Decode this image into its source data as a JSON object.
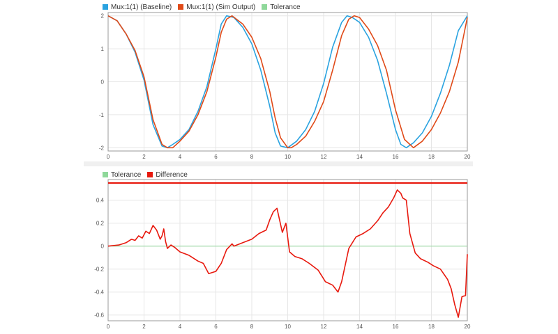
{
  "chart_data": [
    {
      "type": "line",
      "legend": [
        {
          "name": "Mux:1(1) (Baseline)",
          "color": "#2aa3e0"
        },
        {
          "name": "Mux:1(1) (Sim Output)",
          "color": "#e04a18"
        },
        {
          "name": "Tolerance",
          "color": "#8fd89a"
        }
      ],
      "xlim": [
        0,
        20
      ],
      "ylim": [
        -2.1,
        2.1
      ],
      "x_ticks": [
        "0",
        "2",
        "4",
        "6",
        "8",
        "10",
        "12",
        "14",
        "16",
        "18",
        "20"
      ],
      "y_ticks": [
        "2",
        "1",
        "0",
        "-1",
        "-2"
      ],
      "grid": true,
      "legend_position": "top-left",
      "series": [
        {
          "name": "Mux:1(1) (Baseline)",
          "color": "#2aa3e0",
          "x": [
            0,
            0.5,
            1,
            1.5,
            2,
            2.5,
            3,
            3.3,
            3.6,
            4,
            4.5,
            5,
            5.5,
            6,
            6.3,
            6.6,
            7,
            7.5,
            8,
            8.5,
            9,
            9.3,
            9.6,
            10,
            10.5,
            11,
            11.5,
            12,
            12.5,
            13,
            13.3,
            13.6,
            14,
            14.5,
            15,
            15.5,
            16,
            16.3,
            16.6,
            17,
            17.5,
            18,
            18.5,
            19,
            19.5,
            20
          ],
          "y": [
            2.0,
            1.85,
            1.45,
            0.9,
            0.05,
            -1.3,
            -1.95,
            -2.0,
            -1.9,
            -1.75,
            -1.45,
            -0.9,
            -0.15,
            1.0,
            1.75,
            2.0,
            1.95,
            1.65,
            1.15,
            0.35,
            -0.75,
            -1.55,
            -1.95,
            -2.0,
            -1.8,
            -1.45,
            -0.9,
            -0.05,
            1.05,
            1.8,
            2.0,
            1.95,
            1.8,
            1.35,
            0.65,
            -0.35,
            -1.45,
            -1.9,
            -2.0,
            -1.85,
            -1.55,
            -1.05,
            -0.35,
            0.5,
            1.55,
            2.0
          ]
        },
        {
          "name": "Mux:1(1) (Sim Output)",
          "color": "#e04a18",
          "x": [
            0,
            0.5,
            1,
            1.5,
            2,
            2.5,
            3,
            3.3,
            3.6,
            4,
            4.5,
            5,
            5.5,
            6,
            6.3,
            6.6,
            6.9,
            7.5,
            8,
            8.5,
            9,
            9.3,
            9.6,
            10,
            10.2,
            10.5,
            11,
            11.5,
            12,
            12.5,
            13,
            13.4,
            13.7,
            14,
            14.5,
            15,
            15.5,
            16,
            16.5,
            17,
            17.5,
            18,
            18.5,
            19,
            19.5,
            20
          ],
          "y": [
            2.0,
            1.85,
            1.45,
            0.95,
            0.15,
            -1.15,
            -1.9,
            -2.0,
            -2.0,
            -1.8,
            -1.5,
            -1.0,
            -0.3,
            0.75,
            1.5,
            1.9,
            2.0,
            1.75,
            1.35,
            0.7,
            -0.3,
            -1.1,
            -1.7,
            -2.0,
            -2.0,
            -1.9,
            -1.65,
            -1.2,
            -0.6,
            0.35,
            1.4,
            1.9,
            2.0,
            1.95,
            1.6,
            1.1,
            0.35,
            -0.85,
            -1.75,
            -2.0,
            -1.8,
            -1.45,
            -0.95,
            -0.3,
            0.6,
            1.95
          ]
        },
        {
          "name": "Tolerance",
          "color": "#8fd89a",
          "x": [],
          "y": []
        }
      ]
    },
    {
      "type": "line",
      "legend": [
        {
          "name": "Tolerance",
          "color": "#8fd89a"
        },
        {
          "name": "Difference",
          "color": "#e8190e"
        }
      ],
      "xlim": [
        0,
        20
      ],
      "ylim": [
        -0.65,
        0.58
      ],
      "x_ticks": [
        "0",
        "2",
        "4",
        "6",
        "8",
        "10",
        "12",
        "14",
        "16",
        "18",
        "20"
      ],
      "y_ticks": [
        "0.4",
        "0.2",
        "0",
        "-0.2",
        "-0.4",
        "-0.6"
      ],
      "grid": true,
      "legend_position": "top-left",
      "series": [
        {
          "name": "Tolerance",
          "color": "#8fd89a",
          "x": [
            0,
            20
          ],
          "y": [
            0,
            0
          ]
        },
        {
          "name": "Difference",
          "color": "#e8190e",
          "x": [
            0,
            0.6,
            1.0,
            1.3,
            1.5,
            1.7,
            1.9,
            2.1,
            2.3,
            2.5,
            2.7,
            2.9,
            3.0,
            3.1,
            3.2,
            3.3,
            3.5,
            3.7,
            4.0,
            4.5,
            5.0,
            5.3,
            5.6,
            6.0,
            6.3,
            6.6,
            6.9,
            7.0,
            7.5,
            8.0,
            8.4,
            8.8,
            9.0,
            9.2,
            9.4,
            9.7,
            9.9,
            10.1,
            10.4,
            10.8,
            11.2,
            11.7,
            12.1,
            12.5,
            12.8,
            13.0,
            13.4,
            13.8,
            14.2,
            14.6,
            15.0,
            15.3,
            15.6,
            15.9,
            16.1,
            16.3,
            16.4,
            16.6,
            16.8,
            17.1,
            17.4,
            17.8,
            18.1,
            18.5,
            18.9,
            19.1,
            19.3,
            19.5,
            19.7,
            19.9,
            20.0
          ],
          "y": [
            0.0,
            0.01,
            0.03,
            0.06,
            0.05,
            0.09,
            0.07,
            0.13,
            0.11,
            0.18,
            0.14,
            0.06,
            0.09,
            0.15,
            0.04,
            -0.02,
            0.01,
            -0.01,
            -0.05,
            -0.08,
            -0.13,
            -0.15,
            -0.24,
            -0.22,
            -0.15,
            -0.03,
            0.02,
            0.0,
            0.03,
            0.06,
            0.11,
            0.14,
            0.23,
            0.3,
            0.33,
            0.12,
            0.2,
            -0.05,
            -0.09,
            -0.11,
            -0.15,
            -0.21,
            -0.31,
            -0.34,
            -0.4,
            -0.31,
            -0.02,
            0.08,
            0.11,
            0.15,
            0.22,
            0.29,
            0.34,
            0.42,
            0.49,
            0.46,
            0.42,
            0.4,
            0.11,
            -0.06,
            -0.11,
            -0.14,
            -0.17,
            -0.2,
            -0.29,
            -0.37,
            -0.51,
            -0.62,
            -0.44,
            -0.43,
            -0.07
          ]
        },
        {
          "name": "Tolerance (upper bound)",
          "color": "#e8190e",
          "x": [
            0,
            20
          ],
          "y": [
            0.55,
            0.55
          ]
        }
      ]
    }
  ]
}
